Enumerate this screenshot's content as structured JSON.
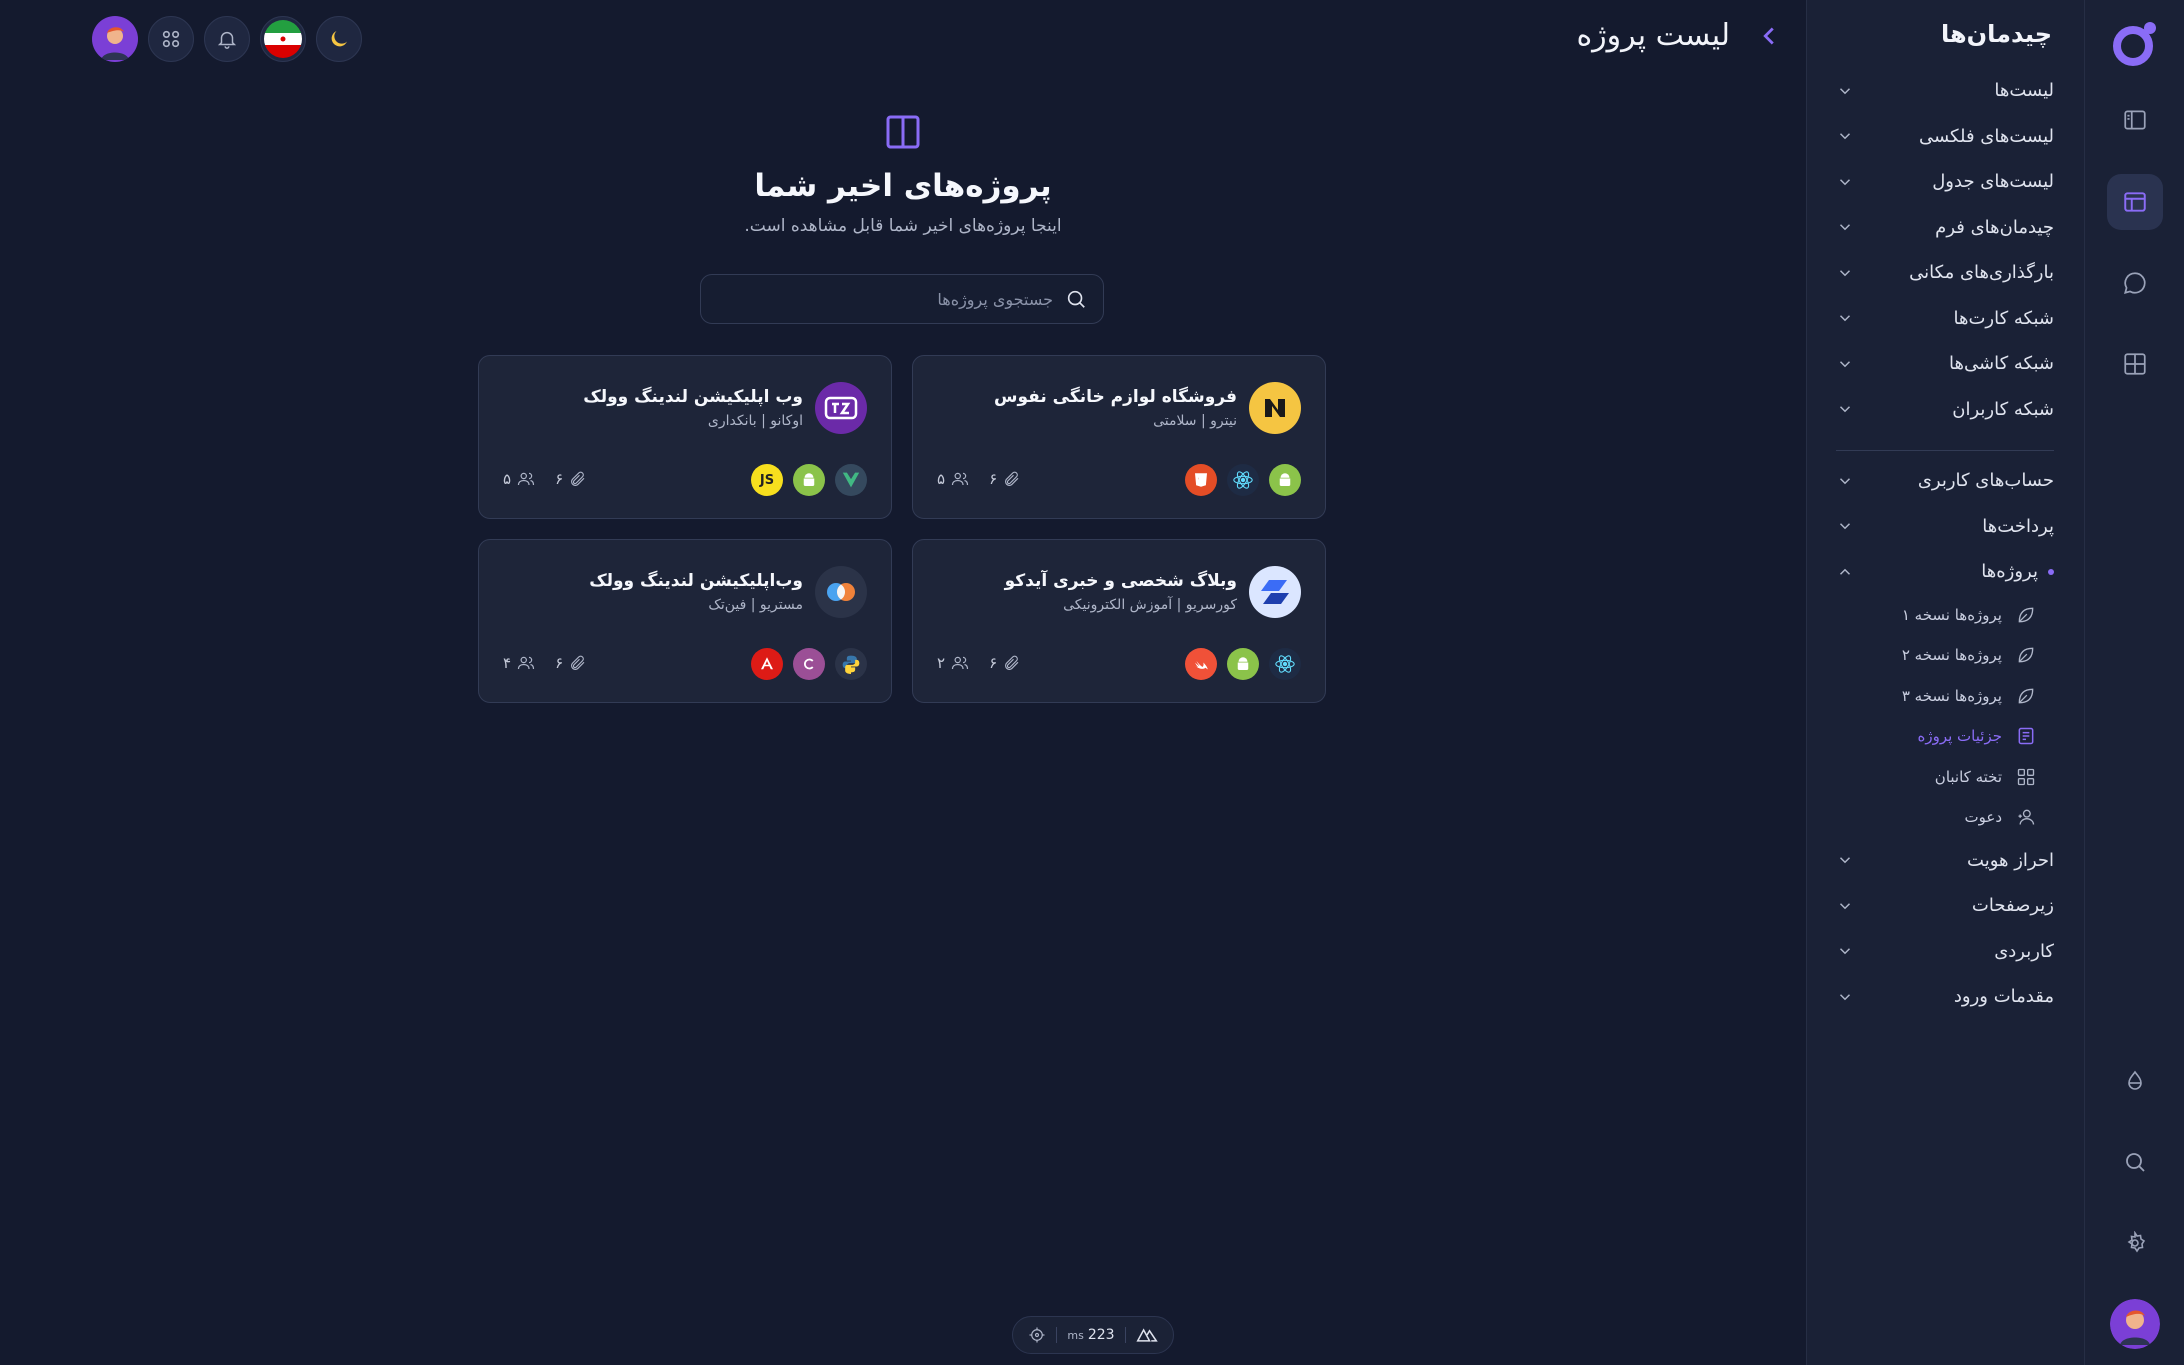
{
  "page": {
    "title": "لیست پروژه",
    "hero_title": "پروژه‌های اخیر شما",
    "hero_subtitle": "اینجا پروژه‌های اخیر شما قابل مشاهده است.",
    "search_placeholder": "جستجوی پروژه‌ها"
  },
  "sidebar": {
    "title": "چیدمان‌ها",
    "top_items": [
      {
        "label": "لیست‌ها"
      },
      {
        "label": "لیست‌های فلکسی"
      },
      {
        "label": "لیست‌های جدول"
      },
      {
        "label": "چیدمان‌های فرم"
      },
      {
        "label": "بارگذاری‌های مکانی"
      },
      {
        "label": "شبکه کارت‌ها"
      },
      {
        "label": "شبکه کاشی‌ها"
      },
      {
        "label": "شبکه کاربران"
      }
    ],
    "bottom_items": [
      {
        "label": "حساب‌های کاربری"
      },
      {
        "label": "پرداخت‌ها"
      }
    ],
    "projects_label": "پروژه‌ها",
    "sub_items": [
      {
        "label": "پروژه‌ها نسخه ۱",
        "icon": "leaf-icon"
      },
      {
        "label": "پروژه‌ها نسخه ۲",
        "icon": "leaf-icon"
      },
      {
        "label": "پروژه‌ها نسخه ۳",
        "icon": "leaf-icon"
      },
      {
        "label": "جزئیات پروژه",
        "icon": "document-icon"
      },
      {
        "label": "تخته کانبان",
        "icon": "grid-icon"
      },
      {
        "label": "دعوت",
        "icon": "user-plus-icon"
      }
    ],
    "tail_items": [
      {
        "label": "احراز هویت"
      },
      {
        "label": "زیرصفحات"
      },
      {
        "label": "کاربردی"
      },
      {
        "label": "مقدمات ورود"
      }
    ]
  },
  "projects": [
    {
      "name": "فروشگاه لوازم خانگی نفوس",
      "meta": "نیترو | سلامتی",
      "files": "۶",
      "members": "۵",
      "logo_color": "#f5c542",
      "techs": [
        "android-icon",
        "react-icon",
        "html5-icon"
      ]
    },
    {
      "name": "وب اپلیکیشن لندینگ وولک",
      "meta": "اوکانو | بانکداری",
      "files": "۶",
      "members": "۵",
      "logo_color": "#6b2aa8",
      "techs": [
        "vue-icon",
        "android-icon",
        "js-icon"
      ]
    },
    {
      "name": "وبلاگ شخصی و خبری آیدکو",
      "meta": "کورسریو | آموزش الکترونیکی",
      "files": "۶",
      "members": "۲",
      "logo_color": "#dbe6ff",
      "techs": [
        "react-icon",
        "android-icon",
        "swift-icon"
      ]
    },
    {
      "name": "وب‌اپلیکیشن لندینگ وولک",
      "meta": "مستریو | فین‌تک",
      "files": "۶",
      "members": "۴",
      "logo_color": "#2b3348",
      "techs": [
        "python-icon",
        "csharp-icon",
        "angular-icon"
      ]
    }
  ],
  "perf": {
    "value": "223",
    "unit": "ms"
  },
  "colors": {
    "accent": "#8a6cf6",
    "background": "#141a2e",
    "card": "#1e2539"
  }
}
